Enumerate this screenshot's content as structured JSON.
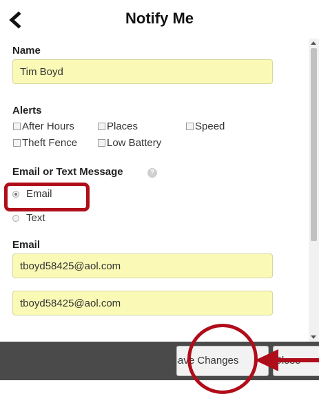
{
  "header": {
    "title": "Notify Me"
  },
  "form": {
    "name_label": "Name",
    "name_value": "Tim Boyd",
    "alerts_label": "Alerts",
    "alerts": [
      "After Hours",
      "Places",
      "Speed",
      "Theft Fence",
      "Low Battery"
    ],
    "contact_label": "Email or Text Message",
    "contact_options": [
      "Email",
      "Text"
    ],
    "contact_selected": "Email",
    "email_label": "Email",
    "email_value": "tboyd58425@aol.com",
    "email_confirm_value": "tboyd58425@aol.com"
  },
  "footer": {
    "save_label": "Save Changes",
    "close_label": "Close"
  },
  "colors": {
    "input_bg": "#fafab6",
    "annotation": "#b00d1a",
    "footer_bg": "#4a4a4a"
  }
}
